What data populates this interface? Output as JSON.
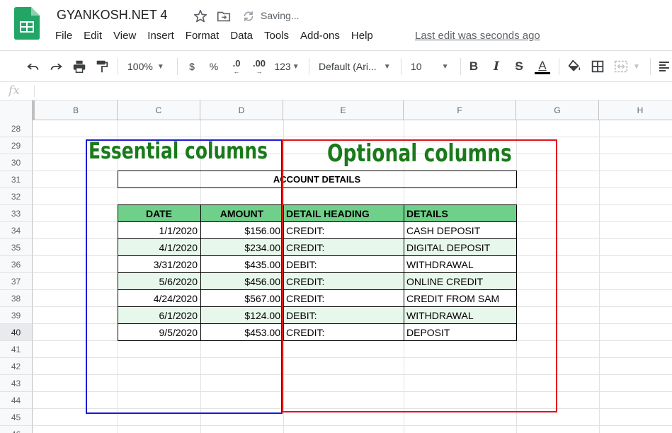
{
  "header": {
    "title": "GYANKOSH.NET 4",
    "saving": "Saving...",
    "last_edit": "Last edit was seconds ago",
    "menu": [
      "File",
      "Edit",
      "View",
      "Insert",
      "Format",
      "Data",
      "Tools",
      "Add-ons",
      "Help"
    ]
  },
  "toolbar": {
    "zoom": "100%",
    "currency": "$",
    "percent": "%",
    "dec_decrease": ".0",
    "dec_increase": ".00",
    "more_formats": "123",
    "font": "Default (Ari...",
    "font_size": "10",
    "bold": "B",
    "italic": "I",
    "strike": "S",
    "text_color": "A"
  },
  "formula_bar": {
    "icon": "fx"
  },
  "columns": [
    "B",
    "C",
    "D",
    "E",
    "F",
    "G",
    "H"
  ],
  "rows": [
    "28",
    "29",
    "30",
    "31",
    "32",
    "33",
    "34",
    "35",
    "36",
    "37",
    "38",
    "39",
    "40",
    "41",
    "42",
    "43",
    "44",
    "45",
    "46"
  ],
  "sheet": {
    "table_title": "ACCOUNT DETAILS",
    "headers": [
      "DATE",
      "AMOUNT",
      "DETAIL HEADING",
      "DETAILS"
    ],
    "data": [
      [
        "1/1/2020",
        "$156.00",
        "CREDIT:",
        "CASH DEPOSIT"
      ],
      [
        "4/1/2020",
        "$234.00",
        "CREDIT:",
        "DIGITAL DEPOSIT"
      ],
      [
        "3/31/2020",
        "$435.00",
        "DEBIT:",
        "WITHDRAWAL"
      ],
      [
        "5/6/2020",
        "$456.00",
        "CREDIT:",
        "ONLINE CREDIT"
      ],
      [
        "4/24/2020",
        "$567.00",
        "CREDIT:",
        "CREDIT FROM SAM"
      ],
      [
        "6/1/2020",
        "$124.00",
        "DEBIT:",
        "WITHDRAWAL"
      ],
      [
        "9/5/2020",
        "$453.00",
        "CREDIT:",
        "DEPOSIT"
      ]
    ]
  },
  "annotations": {
    "essential": "Essential columns",
    "optional": "Optional columns"
  },
  "colors": {
    "header_fill": "#6fd089",
    "alt_row_fill": "#e8f7ec",
    "essential_box": "#1a1ad4",
    "optional_box": "#e0141e",
    "annotation_text": "#1a7a1a"
  }
}
